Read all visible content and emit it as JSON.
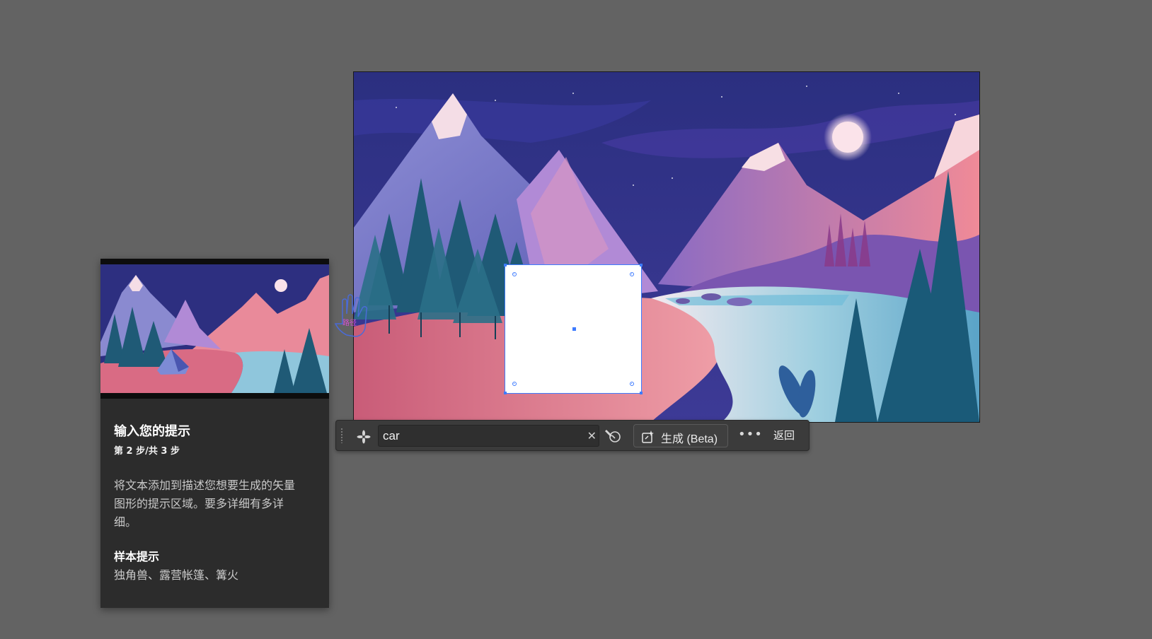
{
  "prompt_bar": {
    "input_value": "car",
    "generate_label": "生成 (Beta)",
    "more_label": "•••",
    "back_label": "返回"
  },
  "cursor": {
    "hint_label": "路径"
  },
  "help_panel": {
    "title": "输入您的提示",
    "step": "第 2 步/共 3 步",
    "body": "将文本添加到描述您想要生成的矢量图形的提示区域。要多详细有多详细。",
    "sample_title": "样本提示",
    "sample_text": "独角兽、露营帐篷、篝火"
  },
  "colors": {
    "canvas_background": "#636363",
    "selection_accent": "#3d7bff",
    "panel_background": "#2c2c2c",
    "bar_background": "#3b3b3b"
  },
  "icons": [
    "sparkle-icon",
    "close-icon",
    "style-picker-icon",
    "generate-icon",
    "more-icon",
    "hand-cursor-icon"
  ]
}
